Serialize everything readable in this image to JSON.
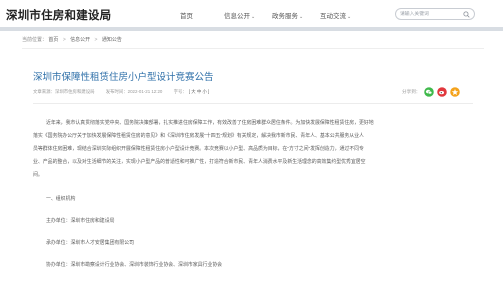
{
  "header": {
    "site_title": "深圳市住房和建设局",
    "nav": [
      {
        "label": "首页",
        "dropdown": false
      },
      {
        "label": "信息公开",
        "dropdown": true
      },
      {
        "label": "政务服务",
        "dropdown": true
      },
      {
        "label": "互动交流",
        "dropdown": true
      }
    ],
    "search_placeholder": "请输入关键词"
  },
  "breadcrumb": {
    "prefix": "当前位置：",
    "items": [
      "首页",
      "信息公开",
      "通知公告"
    ]
  },
  "article": {
    "title": "深圳市保障性租赁住房小户型设计竞赛公告",
    "source": "文章来源：深圳市住房和建设局",
    "date": "发布时间：2022-01-21 12:20",
    "font_size_label": "字号：",
    "font_size_options": "[ 大  中  小 ]",
    "share_label": "分享到：",
    "share_colors": [
      "#3fb94b",
      "#e1373c",
      "#f4a21a"
    ],
    "paragraph_lines": [
      "近年来，我市认真贯彻落实党中央、国务院决策部署，扎实推进住房保障工作，有效改善了住房困难群众居住条件。为加快发展保障性租赁住房，更好地",
      "落实《国务院办公厅关于加快发展保障性租赁住房的意见》和《深圳市住房发展“十四五”规划》有关规定，解决我市新市民、青年人、基本公共服务从业人",
      "员等群体住房困难，现结合深圳实际组织开展保障性租赁住房小户型设计竞赛。本次竞赛以小户型、高品质为目标，在“方寸之间”发挥创造力，通过不同专",
      "业、产品的整合，以及对生活细节的关注，实现小户型产品的普适性和可推广性，打造符合新市民、青年人消费水平及新生活理念的高效集约型优秀宜居空",
      "间。"
    ],
    "sections": [
      "一、组织机构",
      "主办单位：深圳市住房和建设局",
      "承办单位：深圳市人才安居集团有限公司",
      "协办单位：深圳市勘察设计行业协会、深圳市装饰行业协会、深圳市家具行业协会"
    ]
  }
}
